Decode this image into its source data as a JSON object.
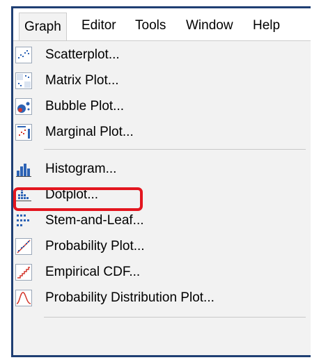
{
  "menubar": {
    "items": [
      "Graph",
      "Editor",
      "Tools",
      "Window",
      "Help"
    ]
  },
  "graph_menu": {
    "items": [
      {
        "label": "Scatterplot...",
        "icon": "scatterplot-icon"
      },
      {
        "label": "Matrix Plot...",
        "icon": "matrix-plot-icon"
      },
      {
        "label": "Bubble Plot...",
        "icon": "bubble-plot-icon"
      },
      {
        "label": "Marginal Plot...",
        "icon": "marginal-plot-icon"
      },
      {
        "label": "Histogram...",
        "icon": "histogram-icon"
      },
      {
        "label": "Dotplot...",
        "icon": "dotplot-icon"
      },
      {
        "label": "Stem-and-Leaf...",
        "icon": "stem-and-leaf-icon"
      },
      {
        "label": "Probability Plot...",
        "icon": "probability-plot-icon"
      },
      {
        "label": "Empirical CDF...",
        "icon": "empirical-cdf-icon"
      },
      {
        "label": "Probability Distribution Plot...",
        "icon": "probability-distribution-plot-icon"
      }
    ],
    "highlighted": "Histogram..."
  },
  "colors": {
    "frame_border": "#1f3f73",
    "menu_background": "#f2f2f2",
    "highlight_outline": "#e3161f",
    "icon_blue": "#2d63b5",
    "icon_red": "#d3372c"
  }
}
